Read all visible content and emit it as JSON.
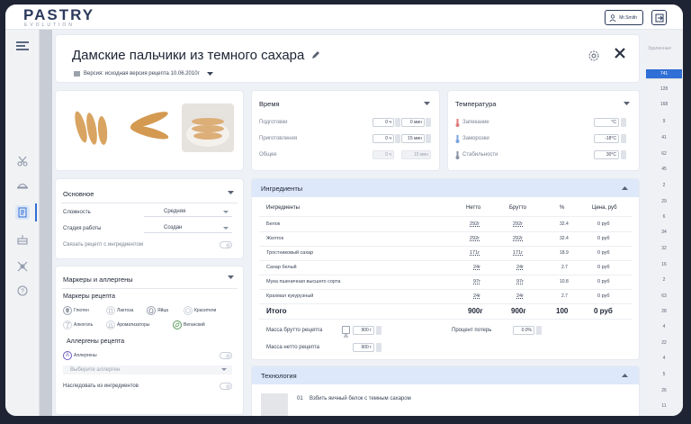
{
  "app": {
    "logo": "PASTRY",
    "logo_sub": "EVOLUTION",
    "user": "Mr.Smith"
  },
  "right_list": {
    "header": "Удаленные",
    "values": [
      "741",
      "128",
      "168",
      "9",
      "41",
      "62",
      "45",
      "2",
      "29",
      "6",
      "34",
      "32",
      "16",
      "2",
      "63",
      "28",
      "4",
      "22",
      "4",
      "5",
      "26",
      "11"
    ]
  },
  "recipe": {
    "title": "Дамские пальчики из темного сахара",
    "version": "Версия: исходная версия рецепта 10.06.2010г"
  },
  "time": {
    "title": "Время",
    "rows": [
      {
        "label": "Подготовки",
        "h": "0 ч",
        "m": "0 мин"
      },
      {
        "label": "Приготовления",
        "h": "0 ч",
        "m": "15 мин"
      },
      {
        "label": "Общее",
        "h": "0 ч",
        "m": "15 мин"
      }
    ]
  },
  "temperature": {
    "title": "Температура",
    "rows": [
      {
        "label": "Запекание",
        "value": "°C"
      },
      {
        "label": "Заморозки",
        "value": "-18°C"
      },
      {
        "label": "Стабильности",
        "value": "30°C"
      }
    ]
  },
  "basic": {
    "title": "Основное",
    "complexity_label": "Сложность",
    "complexity_value": "Средняя",
    "stage_label": "Стадия работы",
    "stage_value": "Создан",
    "link_label": "Связать рецепт с ингредиентом"
  },
  "markers": {
    "title": "Маркеры и аллергены",
    "recipe_markers_title": "Маркеры рецепта",
    "items": [
      "Глютен",
      "Лактоза",
      "Яйца",
      "Красители",
      "Алкоголь",
      "Ароматизаторы",
      "Веганский"
    ],
    "allergens_title": "Аллергены рецепта",
    "allergens_label": "Аллергены",
    "allergen_placeholder": "Выберите аллерген",
    "inherit_label": "Наследовать из ингредиентов"
  },
  "ingredients": {
    "title": "Ингредиенты",
    "headers": [
      "Ингредиенты",
      "Нетто",
      "Брутто",
      "%",
      "Цена, руб"
    ],
    "rows": [
      {
        "name": "Белок",
        "net": "292г",
        "gross": "292г",
        "pct": "32.4",
        "price": "0 руб"
      },
      {
        "name": "Желток",
        "net": "292г",
        "gross": "292г",
        "pct": "32.4",
        "price": "0 руб"
      },
      {
        "name": "Тростниковый сахар",
        "net": "171г",
        "gross": "171г",
        "pct": "18.9",
        "price": "0 руб"
      },
      {
        "name": "Сахар белый",
        "net": "24г",
        "gross": "24г",
        "pct": "2.7",
        "price": "0 руб"
      },
      {
        "name": "Мука пшеничная высшего сорта",
        "net": "97г",
        "gross": "97г",
        "pct": "10.8",
        "price": "0 руб"
      },
      {
        "name": "Крахмал кукурузный",
        "net": "24г",
        "gross": "24г",
        "pct": "2.7",
        "price": "0 руб"
      }
    ],
    "total": {
      "name": "Итого",
      "net": "900г",
      "gross": "900г",
      "pct": "100",
      "price": "0 руб"
    },
    "gross_mass_label": "Масса брутто рецепта",
    "gross_mass_value": "900 г",
    "net_mass_label": "Масса нетто рецепта",
    "net_mass_value": "900 г",
    "loss_label": "Процент потерь",
    "loss_value": "0.0%"
  },
  "technology": {
    "title": "Технология",
    "step_num": "01",
    "step_text": "Взбить яичный белок с темным сахаром"
  },
  "colors": {
    "accent": "#2f6fd6",
    "section_header": "#dde8fa"
  }
}
